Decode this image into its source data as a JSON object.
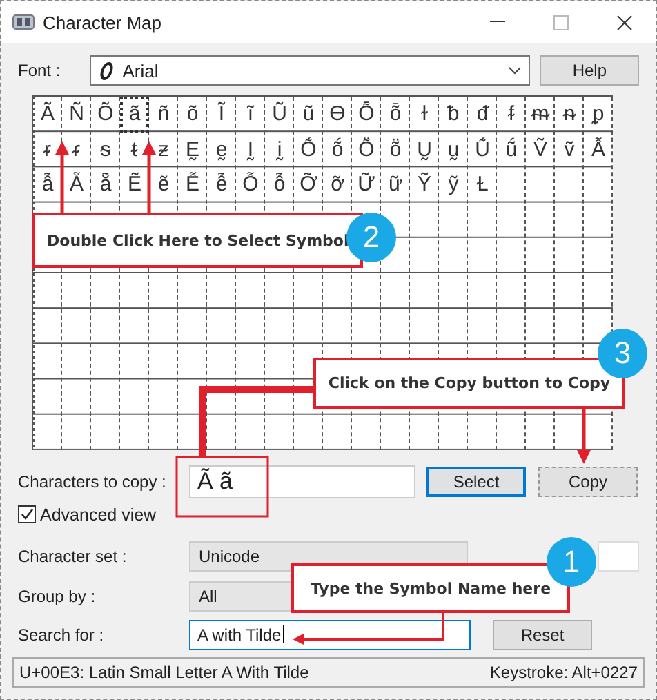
{
  "window": {
    "title": "Character Map"
  },
  "font": {
    "label": "Font :",
    "value": "Arial"
  },
  "help_button": "Help",
  "grid": {
    "rows": [
      {
        "cells": [
          {
            "char": "Ã",
            "selected": false
          },
          {
            "char": "Ñ",
            "selected": false
          },
          {
            "char": "Õ",
            "selected": false
          },
          {
            "char": "ã",
            "selected": true
          },
          {
            "char": "ñ",
            "selected": false
          },
          {
            "char": "õ",
            "selected": false
          },
          {
            "char": "Ĩ",
            "selected": false
          },
          {
            "char": "ĩ",
            "selected": false
          },
          {
            "char": "Ũ",
            "selected": false
          },
          {
            "char": "ũ",
            "selected": false
          },
          {
            "char": "Ɵ",
            "selected": false
          },
          {
            "char": "Ȭ",
            "selected": false
          },
          {
            "char": "ȭ",
            "selected": false
          },
          {
            "char": "ɫ",
            "selected": false
          },
          {
            "char": "ᵬ",
            "selected": false
          },
          {
            "char": "ᵭ",
            "selected": false
          },
          {
            "char": "ᵮ",
            "selected": false
          },
          {
            "char": "ᵯ",
            "selected": false
          },
          {
            "char": "ᵰ",
            "selected": false
          },
          {
            "char": "ᵱ",
            "selected": false
          }
        ]
      },
      {
        "cells": [
          {
            "char": "ᵲ",
            "selected": false
          },
          {
            "char": "ᵳ",
            "selected": false
          },
          {
            "char": "ᵴ",
            "selected": false
          },
          {
            "char": "ᵵ",
            "selected": false
          },
          {
            "char": "ᵶ",
            "selected": false
          },
          {
            "char": "Ḛ",
            "selected": false
          },
          {
            "char": "ḛ",
            "selected": false
          },
          {
            "char": "Ḭ",
            "selected": false
          },
          {
            "char": "ḭ",
            "selected": false
          },
          {
            "char": "Ṍ",
            "selected": false
          },
          {
            "char": "ṍ",
            "selected": false
          },
          {
            "char": "Ṏ",
            "selected": false
          },
          {
            "char": "ṏ",
            "selected": false
          },
          {
            "char": "Ṵ",
            "selected": false
          },
          {
            "char": "ṵ",
            "selected": false
          },
          {
            "char": "Ṹ",
            "selected": false
          },
          {
            "char": "ṹ",
            "selected": false
          },
          {
            "char": "Ṽ",
            "selected": false
          },
          {
            "char": "ṽ",
            "selected": false
          },
          {
            "char": "Ẫ",
            "selected": false
          }
        ]
      },
      {
        "cells": [
          {
            "char": "ẫ",
            "selected": false
          },
          {
            "char": "Ẵ",
            "selected": false
          },
          {
            "char": "ẵ",
            "selected": false
          },
          {
            "char": "Ẽ",
            "selected": false
          },
          {
            "char": "ẽ",
            "selected": false
          },
          {
            "char": "Ễ",
            "selected": false
          },
          {
            "char": "ễ",
            "selected": false
          },
          {
            "char": "Ỗ",
            "selected": false
          },
          {
            "char": "ỗ",
            "selected": false
          },
          {
            "char": "Ỡ",
            "selected": false
          },
          {
            "char": "ỡ",
            "selected": false
          },
          {
            "char": "Ữ",
            "selected": false
          },
          {
            "char": "ữ",
            "selected": false
          },
          {
            "char": "Ỹ",
            "selected": false
          },
          {
            "char": "ỹ",
            "selected": false
          },
          {
            "char": "Ɫ",
            "selected": false
          }
        ]
      }
    ]
  },
  "copy": {
    "label": "Characters to copy :",
    "value": "Ã ã",
    "select_button": "Select",
    "copy_button": "Copy"
  },
  "advanced_view": {
    "label": "Advanced view",
    "checked": true
  },
  "character_set": {
    "label": "Character set :",
    "value": "Unicode"
  },
  "group_by": {
    "label": "Group by :",
    "value": "All"
  },
  "search": {
    "label": "Search for :",
    "value": "A with Tilde",
    "reset_button": "Reset"
  },
  "status_bar": {
    "character": "U+00E3: Latin Small Letter A With Tilde",
    "keystroke": "Keystroke: Alt+0227"
  },
  "annotations": [
    {
      "number": "2",
      "text": "Double Click Here to Select Symbol"
    },
    {
      "number": "3",
      "text": "Click on the Copy button to Copy"
    },
    {
      "number": "1",
      "text": "Type the Symbol Name here"
    }
  ]
}
